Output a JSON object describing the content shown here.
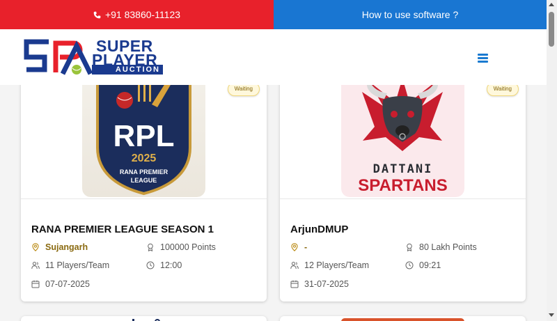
{
  "topbar": {
    "phone": "+91 83860-11123",
    "howto": "How to use software ?"
  },
  "header": {
    "logo_super": "SUPER",
    "logo_player": "PLAYER",
    "logo_auction": "AUCTION",
    "logo_initials": "SPA"
  },
  "colors": {
    "red": "#e8212b",
    "blue": "#1976d2",
    "navy": "#1a3a8f",
    "gold": "#8a6a10"
  },
  "cards": [
    {
      "status": "Waiting",
      "logo": {
        "acronym": "RPL",
        "year": "2025",
        "line1": "RANA PREMIER",
        "line2": "LEAGUE"
      },
      "title": "RANA PREMIER LEAGUE SEASON 1",
      "location": "Sujangarh",
      "points": "100000 Points",
      "players": "11 Players/Team",
      "time": "12:00",
      "date": "07-07-2025"
    },
    {
      "status": "Waiting",
      "logo": {
        "line1": "DATTANI",
        "line2": "SPARTANS"
      },
      "title": "ArjunDMUP",
      "location": "-",
      "points": "80 Lakh Points",
      "players": "12 Players/Team",
      "time": "09:21",
      "date": "31-07-2025"
    }
  ]
}
